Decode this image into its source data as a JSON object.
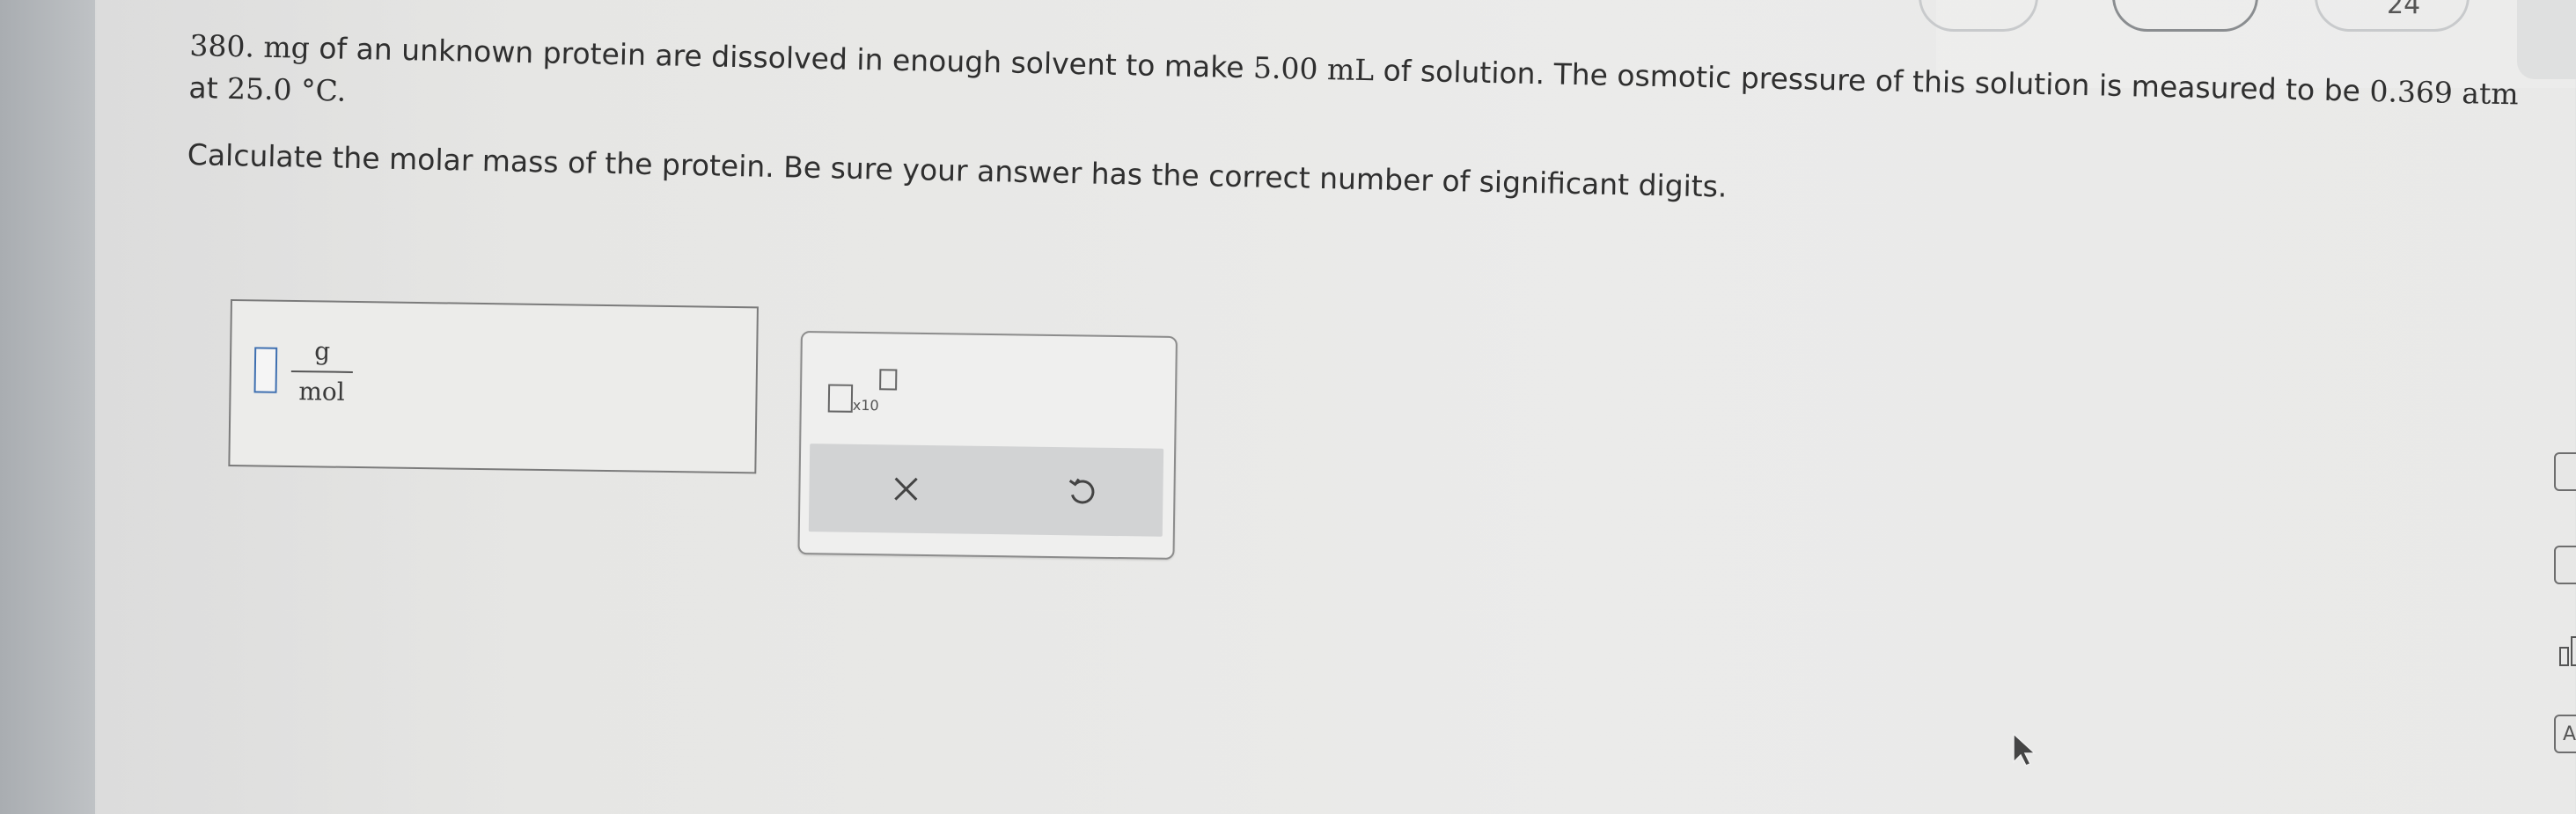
{
  "question": {
    "line1_number": "380.",
    "line1_unit": "mg",
    "line1_text_a": "of an unknown protein are dissolved in enough solvent to make",
    "line1_volume": "5.00 mL",
    "line1_text_b": "of solution. The osmotic pressure of this solution is measured to be",
    "line1_pressure": "0.369 atm",
    "line2_text": "at",
    "line2_temperature": "25.0 °C",
    "line2_period": ".",
    "line3_text": "Calculate the molar mass of the protein. Be sure your answer has the correct number of significant digits."
  },
  "answer": {
    "value": "",
    "unit_numerator": "g",
    "unit_denominator": "mol"
  },
  "tools": {
    "sci_notation_multiplier": "x10",
    "clear_icon": "close-icon",
    "undo_icon": "undo-icon"
  },
  "top_bar": {
    "number": "24"
  },
  "right_tools": {
    "item4_label": "Ar"
  }
}
